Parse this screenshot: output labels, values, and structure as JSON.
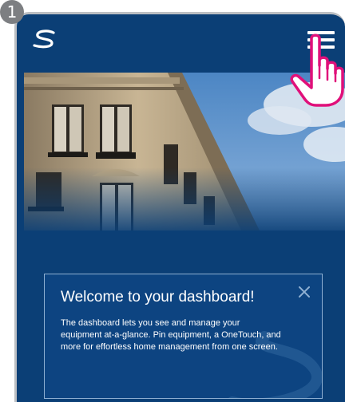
{
  "step": {
    "number": "1"
  },
  "header": {
    "logo_icon": "brand-swoosh-icon",
    "menu_icon": "hamburger-menu-icon",
    "pointer_icon": "pointing-hand-icon"
  },
  "hero": {
    "image": "building-facade-photo"
  },
  "welcome": {
    "title": "Welcome to your dashboard!",
    "body": "The dashboard lets you see and manage your equipment at-a-glance. Pin equipment, a OneTouch, and more for effortless home management from one screen.",
    "close_icon": "close-icon"
  },
  "colors": {
    "background": "#0b3f76",
    "card": "#0d4481",
    "card_border": "#8fb0d2",
    "accent_pointer": "#e0107a",
    "frame": "#bcbfc3",
    "badge": "#7d7f82"
  }
}
